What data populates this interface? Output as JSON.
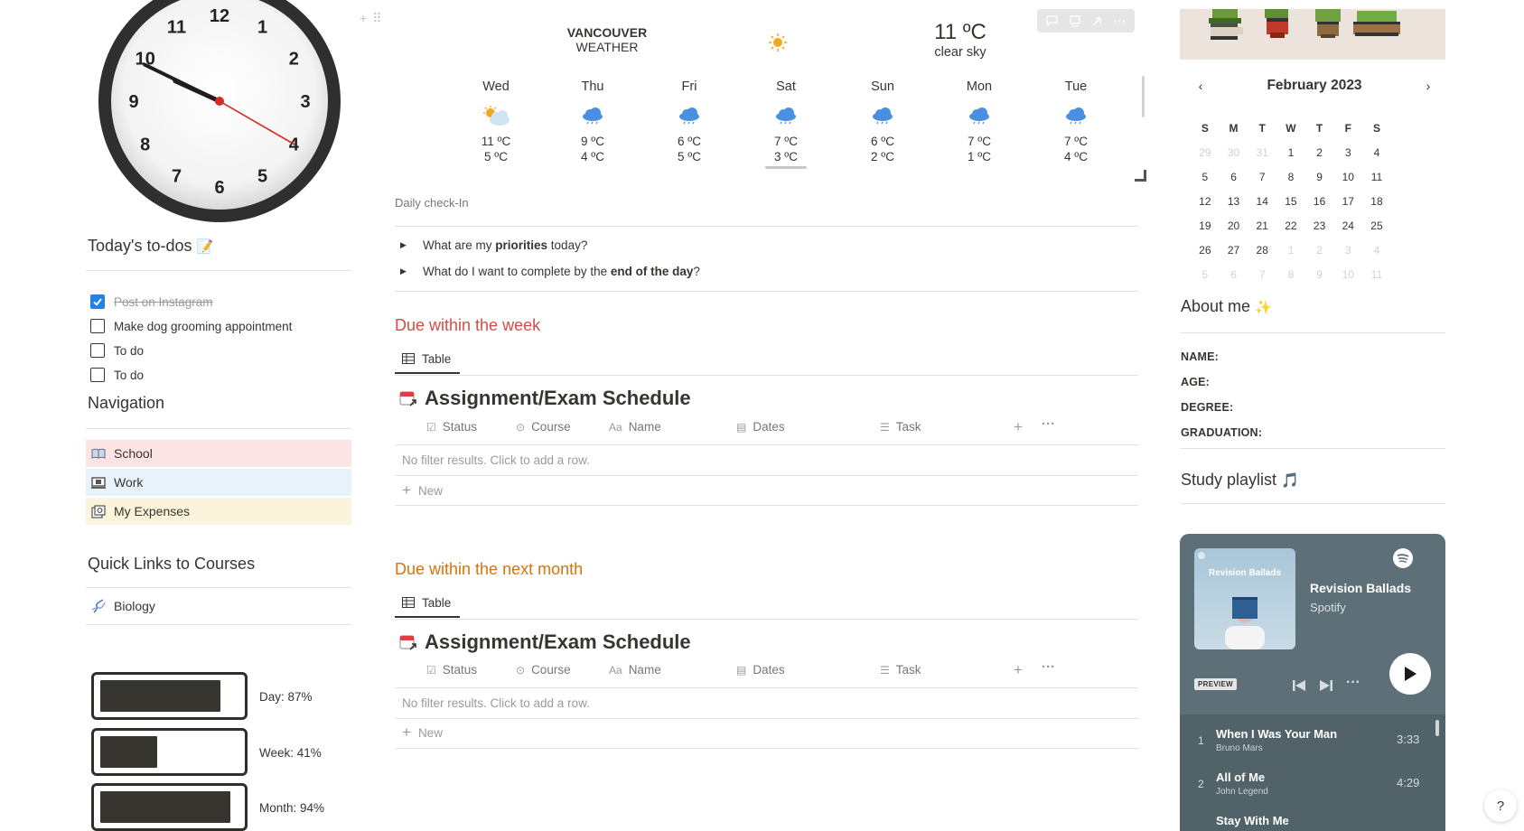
{
  "clock": {
    "hour": 9,
    "minute": 49,
    "second": 20
  },
  "todos": {
    "title": "Today's to-dos",
    "title_emoji": "📝",
    "items": [
      {
        "label": "Post on Instagram",
        "checked": true
      },
      {
        "label": "Make dog grooming appointment",
        "checked": false
      },
      {
        "label": "To do",
        "checked": false
      },
      {
        "label": "To do",
        "checked": false
      }
    ]
  },
  "navigation": {
    "title": "Navigation",
    "items": [
      {
        "label": "School",
        "icon": "book-icon",
        "color": "#fbe4e4"
      },
      {
        "label": "Work",
        "icon": "laptop-icon",
        "color": "#e7f3f8"
      },
      {
        "label": "My Expenses",
        "icon": "receipt-icon",
        "color": "#fbf3db"
      }
    ]
  },
  "quick_links": {
    "title": "Quick Links to Courses",
    "items": [
      {
        "label": "Biology",
        "icon": "dna-icon"
      }
    ]
  },
  "progress": [
    {
      "label": "Day: 87%",
      "value": 0.87
    },
    {
      "label": "Week: 41%",
      "value": 0.41
    },
    {
      "label": "Month: 94%",
      "value": 0.94
    }
  ],
  "weather": {
    "city": "VANCOUVER",
    "subtitle": "WEATHER",
    "temp": "11 ºC",
    "desc": "clear sky",
    "days": [
      {
        "name": "Wed",
        "hi": "11 ºC",
        "lo": "5 ºC",
        "icon": "partly-cloudy-icon"
      },
      {
        "name": "Thu",
        "hi": "9 ºC",
        "lo": "4 ºC",
        "icon": "rain-icon"
      },
      {
        "name": "Fri",
        "hi": "6 ºC",
        "lo": "5 ºC",
        "icon": "rain-icon"
      },
      {
        "name": "Sat",
        "hi": "7 ºC",
        "lo": "3 ºC",
        "icon": "rain-icon"
      },
      {
        "name": "Sun",
        "hi": "6 ºC",
        "lo": "2 ºC",
        "icon": "rain-icon"
      },
      {
        "name": "Mon",
        "hi": "7 ºC",
        "lo": "1 ºC",
        "icon": "rain-icon"
      },
      {
        "name": "Tue",
        "hi": "7 ºC",
        "lo": "4 ºC",
        "icon": "rain-icon"
      }
    ]
  },
  "checkin": {
    "label": "Daily check-In",
    "q1": {
      "pre": "What are my ",
      "bold": "priorities",
      "post": " today?"
    },
    "q2": {
      "pre": "What do I want to complete by the ",
      "bold": "end of the day",
      "post": "?"
    }
  },
  "week_section": {
    "heading": "Due within the week",
    "heading_color": "#d44c47",
    "tab": "Table",
    "db_title": "Assignment/Exam Schedule",
    "columns": [
      "Status",
      "Course",
      "Name",
      "Dates",
      "Task"
    ],
    "empty": "No filter results. Click to add a row.",
    "new": "New"
  },
  "month_section": {
    "heading": "Due within the next month",
    "heading_color": "#d9730d",
    "tab": "Table",
    "db_title": "Assignment/Exam Schedule",
    "columns": [
      "Status",
      "Course",
      "Name",
      "Dates",
      "Task"
    ],
    "empty": "No filter results. Click to add a row.",
    "new": "New"
  },
  "calendar": {
    "title": "February 2023",
    "dow": [
      "S",
      "M",
      "T",
      "W",
      "T",
      "F",
      "S"
    ],
    "weeks": [
      [
        {
          "d": "29",
          "m": true
        },
        {
          "d": "30",
          "m": true
        },
        {
          "d": "31",
          "m": true
        },
        {
          "d": "1"
        },
        {
          "d": "2"
        },
        {
          "d": "3"
        },
        {
          "d": "4"
        }
      ],
      [
        {
          "d": "5"
        },
        {
          "d": "6"
        },
        {
          "d": "7"
        },
        {
          "d": "8"
        },
        {
          "d": "9"
        },
        {
          "d": "10"
        },
        {
          "d": "11"
        }
      ],
      [
        {
          "d": "12"
        },
        {
          "d": "13"
        },
        {
          "d": "14"
        },
        {
          "d": "15"
        },
        {
          "d": "16"
        },
        {
          "d": "17"
        },
        {
          "d": "18"
        }
      ],
      [
        {
          "d": "19"
        },
        {
          "d": "20"
        },
        {
          "d": "21"
        },
        {
          "d": "22"
        },
        {
          "d": "23"
        },
        {
          "d": "24"
        },
        {
          "d": "25"
        }
      ],
      [
        {
          "d": "26"
        },
        {
          "d": "27"
        },
        {
          "d": "28"
        },
        {
          "d": "1",
          "m": true
        },
        {
          "d": "2",
          "m": true
        },
        {
          "d": "3",
          "m": true
        },
        {
          "d": "4",
          "m": true
        }
      ],
      [
        {
          "d": "5",
          "m": true
        },
        {
          "d": "6",
          "m": true
        },
        {
          "d": "7",
          "m": true
        },
        {
          "d": "8",
          "m": true
        },
        {
          "d": "9",
          "m": true
        },
        {
          "d": "10",
          "m": true
        },
        {
          "d": "11",
          "m": true
        }
      ]
    ]
  },
  "about": {
    "title": "About me",
    "title_emoji": "✨",
    "fields": [
      "NAME:",
      "AGE:",
      "DEGREE:",
      "GRADUATION:"
    ]
  },
  "playlist": {
    "title": "Study playlist",
    "title_emoji": "🎵",
    "album_label": "Revision Ballads",
    "name": "Revision Ballads",
    "source": "Spotify",
    "preview": "PREVIEW",
    "tracks": [
      {
        "num": "1",
        "name": "When I Was Your Man",
        "artist": "Bruno Mars",
        "dur": "3:33"
      },
      {
        "num": "2",
        "name": "All of Me",
        "artist": "John Legend",
        "dur": "4:29"
      },
      {
        "num": "",
        "name": "Stay With Me",
        "artist": "",
        "dur": ""
      }
    ]
  },
  "help": "?"
}
